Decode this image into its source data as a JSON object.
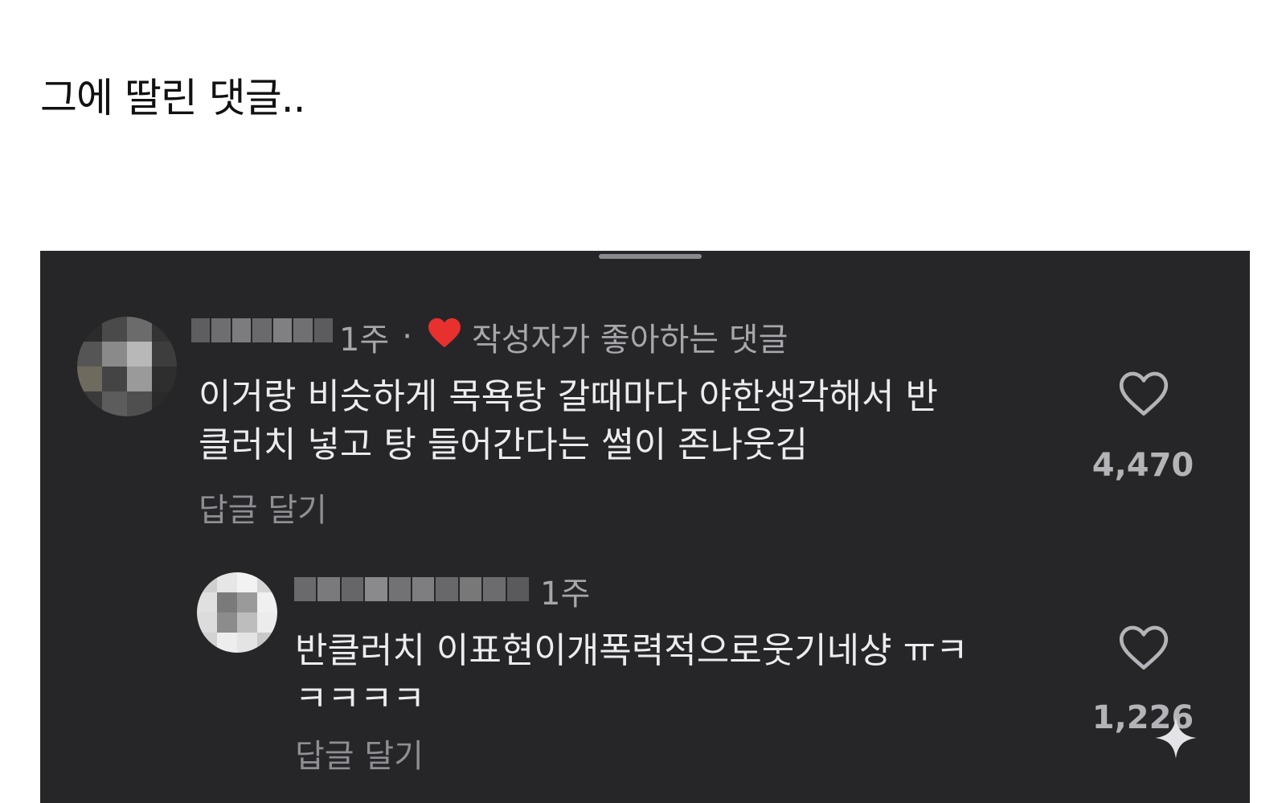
{
  "caption": "그에 딸린 댓글..",
  "comments": [
    {
      "time": "1주",
      "separator": "·",
      "author_liked_label": "작성자가 좋아하는 댓글",
      "text": "이거랑 비슷하게 목욕탕 갈때마다 야한생각해서 반\n클러치 넣고 탕 들어간다는 썰이 존나웃김",
      "reply_label": "답글 달기",
      "like_count": "4,470"
    },
    {
      "time": "1주",
      "text": "반클러치 이표현이개폭력적으로웃기네샹 ㅠㅋ\nㅋㅋㅋㅋ",
      "reply_label": "답글 달기",
      "like_count": "1,226"
    }
  ],
  "colors": {
    "panel_bg": "#262628",
    "author_heart": "#e8302f",
    "text_primary": "#ececee",
    "text_secondary": "#a7a7ab"
  },
  "icons": [
    "heart-outline-icon",
    "heart-filled-icon",
    "sparkle-icon"
  ]
}
